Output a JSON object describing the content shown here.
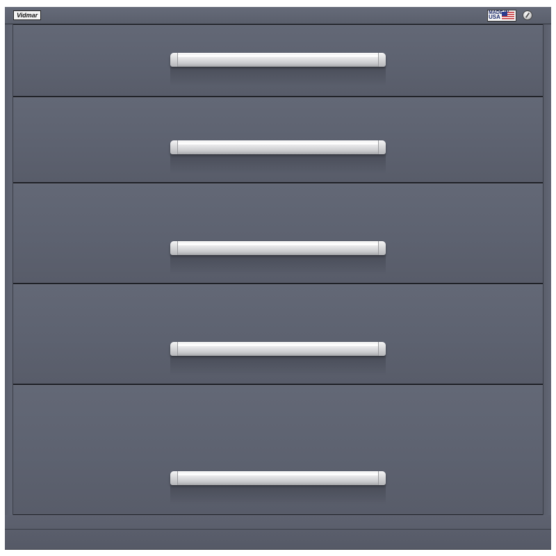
{
  "header": {
    "brand_logo": "Vidmar",
    "made_in_top": "MADE IN",
    "made_in_country": "USA"
  },
  "colors": {
    "cabinet": "#5d6270",
    "handle": "#e4e4e6",
    "flag_red": "#c0282d",
    "flag_blue": "#2b3b8f"
  },
  "drawers": [
    {
      "name": "drawer-1"
    },
    {
      "name": "drawer-2"
    },
    {
      "name": "drawer-3"
    },
    {
      "name": "drawer-4"
    },
    {
      "name": "drawer-5"
    }
  ],
  "icons": {
    "lock": "key-lock-icon",
    "flag": "us-flag-icon"
  }
}
